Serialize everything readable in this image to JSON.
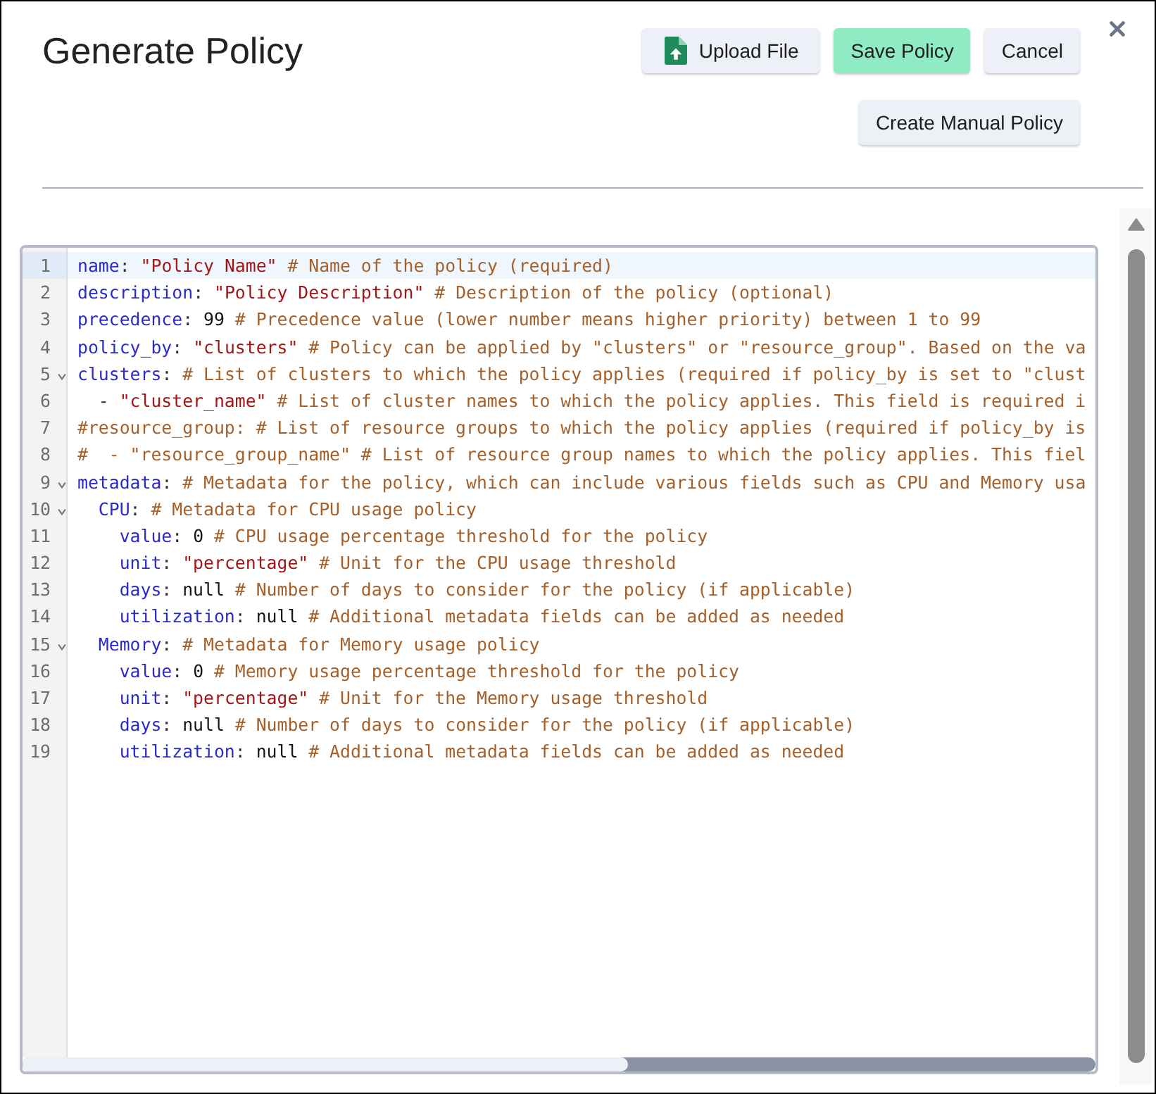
{
  "dialog": {
    "title": "Generate Policy",
    "action_rows": [
      {
        "buttons": [
          {
            "kind": "upload",
            "label": "Upload File"
          },
          {
            "kind": "save",
            "label": "Save Policy"
          },
          {
            "kind": "cancel",
            "label": "Cancel"
          }
        ]
      },
      {
        "buttons": [
          {
            "kind": "create",
            "label": "Create Manual Policy"
          }
        ]
      }
    ]
  },
  "editor": {
    "lines": [
      {
        "number": "1",
        "active": true,
        "tokens": [
          {
            "kind": "key",
            "text": "name"
          },
          {
            "kind": "punct",
            "text": ":"
          },
          {
            "kind": "string",
            "text": " \"Policy Name\""
          },
          {
            "kind": "comment",
            "text": " # Name of the policy (required)"
          }
        ]
      },
      {
        "number": "2",
        "active": false,
        "tokens": [
          {
            "kind": "key",
            "text": "description"
          },
          {
            "kind": "punct",
            "text": ":"
          },
          {
            "kind": "string",
            "text": " \"Policy Description\""
          },
          {
            "kind": "comment",
            "text": " # Description of the policy (optional)"
          }
        ]
      },
      {
        "number": "3",
        "active": false,
        "tokens": [
          {
            "kind": "key",
            "text": "precedence"
          },
          {
            "kind": "punct",
            "text": ":"
          },
          {
            "kind": "value",
            "text": " 99"
          },
          {
            "kind": "comment",
            "text": " # Precedence value (lower number means higher priority) between 1 to 99"
          }
        ]
      },
      {
        "number": "4",
        "active": false,
        "tokens": [
          {
            "kind": "key",
            "text": "policy_by"
          },
          {
            "kind": "punct",
            "text": ":"
          },
          {
            "kind": "string",
            "text": " \"clusters\""
          },
          {
            "kind": "comment",
            "text": " # Policy can be applied by \"clusters\" or \"resource_group\". Based on the va"
          }
        ]
      },
      {
        "number": "5",
        "active": false,
        "expanded": true,
        "tokens": [
          {
            "kind": "key",
            "text": "clusters"
          },
          {
            "kind": "punct",
            "text": ":"
          },
          {
            "kind": "comment",
            "text": " # List of clusters to which the policy applies (required if policy_by is set to \"clust"
          }
        ],
        "children": [
          {
            "number": "6",
            "active": false,
            "tokens": [
              {
                "kind": "punct",
                "text": "- "
              },
              {
                "kind": "string",
                "text": "\"cluster_name\""
              },
              {
                "kind": "comment",
                "text": " # List of cluster names to which the policy applies. This field is required i"
              }
            ]
          }
        ]
      },
      {
        "number": "7",
        "active": false,
        "tokens": [
          {
            "kind": "comment",
            "text": "#resource_group: # List of resource groups to which the policy applies (required if policy_by is"
          }
        ]
      },
      {
        "number": "8",
        "active": false,
        "tokens": [
          {
            "kind": "comment",
            "text": "#  - \"resource_group_name\" # List of resource group names to which the policy applies. This fiel"
          }
        ]
      },
      {
        "number": "9",
        "active": false,
        "expanded": true,
        "tokens": [
          {
            "kind": "key",
            "text": "metadata"
          },
          {
            "kind": "punct",
            "text": ":"
          },
          {
            "kind": "comment",
            "text": " # Metadata for the policy, which can include various fields such as CPU and Memory usa"
          }
        ],
        "children": [
          {
            "number": "10",
            "active": false,
            "expanded": true,
            "tokens": [
              {
                "kind": "key",
                "text": "CPU"
              },
              {
                "kind": "punct",
                "text": ":"
              },
              {
                "kind": "comment",
                "text": " # Metadata for CPU usage policy"
              }
            ],
            "children": [
              {
                "number": "11",
                "active": false,
                "tokens": [
                  {
                    "kind": "key",
                    "text": "value"
                  },
                  {
                    "kind": "punct",
                    "text": ":"
                  },
                  {
                    "kind": "value",
                    "text": " 0"
                  },
                  {
                    "kind": "comment",
                    "text": " # CPU usage percentage threshold for the policy"
                  }
                ]
              },
              {
                "number": "12",
                "active": false,
                "tokens": [
                  {
                    "kind": "key",
                    "text": "unit"
                  },
                  {
                    "kind": "punct",
                    "text": ":"
                  },
                  {
                    "kind": "string",
                    "text": " \"percentage\""
                  },
                  {
                    "kind": "comment",
                    "text": " # Unit for the CPU usage threshold"
                  }
                ]
              },
              {
                "number": "13",
                "active": false,
                "tokens": [
                  {
                    "kind": "key",
                    "text": "days"
                  },
                  {
                    "kind": "punct",
                    "text": ":"
                  },
                  {
                    "kind": "value",
                    "text": " null"
                  },
                  {
                    "kind": "comment",
                    "text": " # Number of days to consider for the policy (if applicable)"
                  }
                ]
              },
              {
                "number": "14",
                "active": false,
                "tokens": [
                  {
                    "kind": "key",
                    "text": "utilization"
                  },
                  {
                    "kind": "punct",
                    "text": ":"
                  },
                  {
                    "kind": "value",
                    "text": " null"
                  },
                  {
                    "kind": "comment",
                    "text": " # Additional metadata fields can be added as needed"
                  }
                ]
              }
            ]
          },
          {
            "number": "15",
            "active": false,
            "expanded": true,
            "tokens": [
              {
                "kind": "key",
                "text": "Memory"
              },
              {
                "kind": "punct",
                "text": ":"
              },
              {
                "kind": "comment",
                "text": " # Metadata for Memory usage policy"
              }
            ],
            "children": [
              {
                "number": "16",
                "active": false,
                "tokens": [
                  {
                    "kind": "key",
                    "text": "value"
                  },
                  {
                    "kind": "punct",
                    "text": ":"
                  },
                  {
                    "kind": "value",
                    "text": " 0"
                  },
                  {
                    "kind": "comment",
                    "text": " # Memory usage percentage threshold for the policy"
                  }
                ]
              },
              {
                "number": "17",
                "active": false,
                "tokens": [
                  {
                    "kind": "key",
                    "text": "unit"
                  },
                  {
                    "kind": "punct",
                    "text": ":"
                  },
                  {
                    "kind": "string",
                    "text": " \"percentage\""
                  },
                  {
                    "kind": "comment",
                    "text": " # Unit for the Memory usage threshold"
                  }
                ]
              },
              {
                "number": "18",
                "active": false,
                "tokens": [
                  {
                    "kind": "key",
                    "text": "days"
                  },
                  {
                    "kind": "punct",
                    "text": ":"
                  },
                  {
                    "kind": "value",
                    "text": " null"
                  },
                  {
                    "kind": "comment",
                    "text": " # Number of days to consider for the policy (if applicable)"
                  }
                ]
              },
              {
                "number": "19",
                "active": false,
                "tokens": [
                  {
                    "kind": "key",
                    "text": "utilization"
                  },
                  {
                    "kind": "punct",
                    "text": ":"
                  },
                  {
                    "kind": "value",
                    "text": " null"
                  },
                  {
                    "kind": "comment",
                    "text": " # Additional metadata fields can be added as needed"
                  }
                ]
              }
            ]
          }
        ]
      }
    ]
  }
}
